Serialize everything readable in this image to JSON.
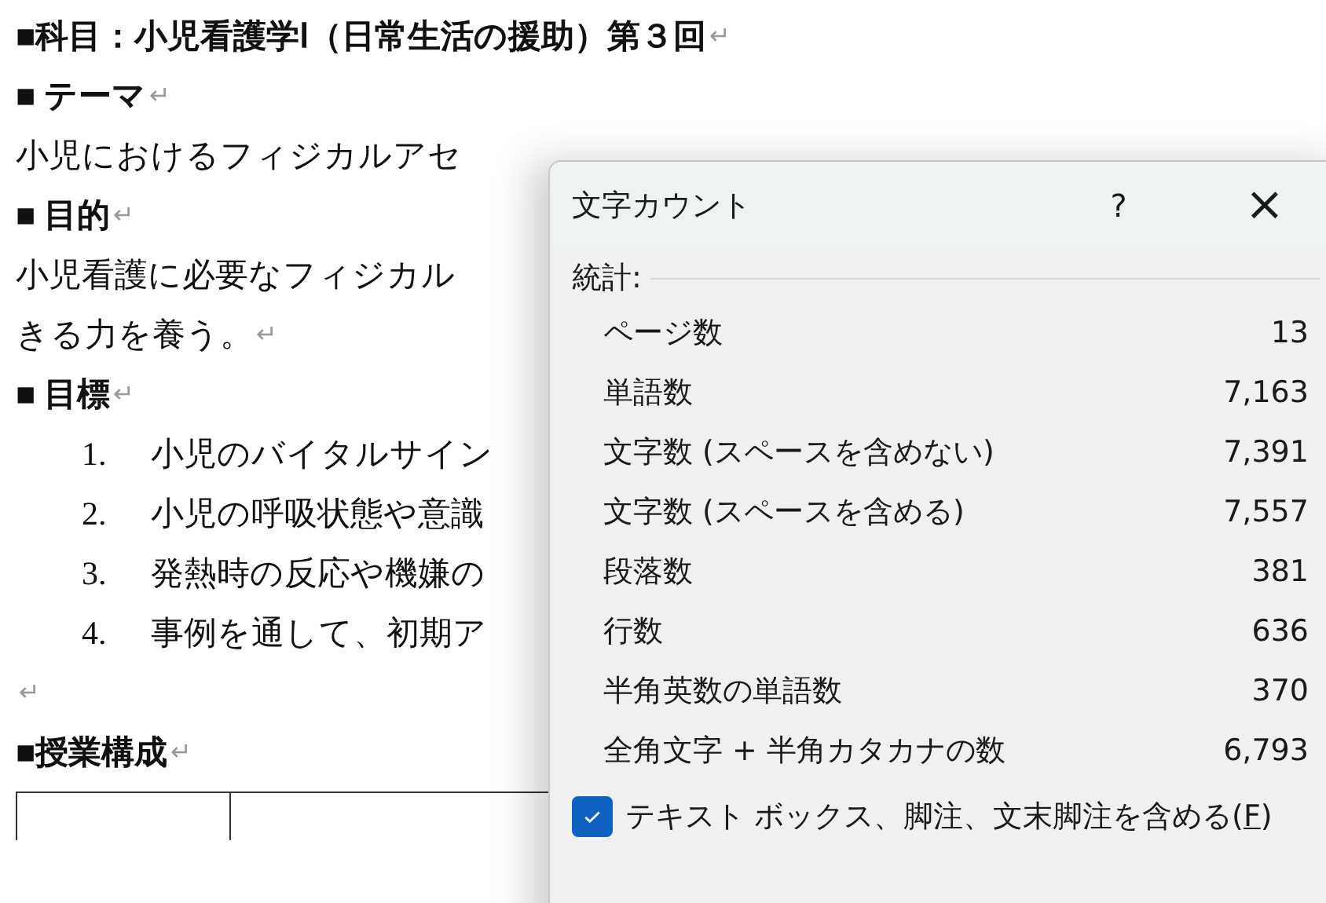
{
  "document": {
    "blocks": [
      {
        "kind": "title",
        "text": "■科目：小児看護学Ⅰ（日常生活の援助）第３回",
        "return_mark": "↵"
      },
      {
        "kind": "heading",
        "text": "■ テーマ",
        "return_mark": "↵"
      },
      {
        "kind": "paragraph",
        "text": "小児におけるフィジカルアセ"
      },
      {
        "kind": "heading",
        "text": "■ 目的",
        "return_mark": "↵"
      },
      {
        "kind": "paragraph",
        "text": "小児看護に必要なフィジカル"
      },
      {
        "kind": "paragraph",
        "text": "きる力を養う。",
        "return_mark": "↵"
      },
      {
        "kind": "heading",
        "text": "■ 目標",
        "return_mark": "↵"
      },
      {
        "kind": "list_item",
        "number": "1.",
        "text": "小児のバイタルサイン"
      },
      {
        "kind": "list_item",
        "number": "2.",
        "text": "小児の呼吸状態や意識"
      },
      {
        "kind": "list_item",
        "number": "3.",
        "text": "発熱時の反応や機嫌の"
      },
      {
        "kind": "list_item",
        "number": "4.",
        "text": "事例を通して、初期ア"
      },
      {
        "kind": "empty",
        "return_mark": "↵"
      },
      {
        "kind": "title",
        "text": "■授業構成",
        "return_mark": "↵"
      },
      {
        "kind": "table"
      }
    ]
  },
  "dialog": {
    "title": "文字カウント",
    "help": "?",
    "close": "×",
    "section": "統計:",
    "stats": [
      {
        "label": "ページ数",
        "value": "13"
      },
      {
        "label": "単語数",
        "value": "7,163"
      },
      {
        "label": "文字数 (スペースを含めない)",
        "value": "7,391"
      },
      {
        "label": "文字数 (スペースを含める)",
        "value": "7,557"
      },
      {
        "label": "段落数",
        "value": "381"
      },
      {
        "label": "行数",
        "value": "636"
      },
      {
        "label": "半角英数の単語数",
        "value": "370"
      },
      {
        "label": "全角文字 + 半角カタカナの数",
        "value": "6,793"
      }
    ],
    "option": {
      "label_before": "テキスト ボックス、脚注、文末脚注を含める(",
      "access_key": "F",
      "label_after": ")",
      "checked": true
    }
  }
}
